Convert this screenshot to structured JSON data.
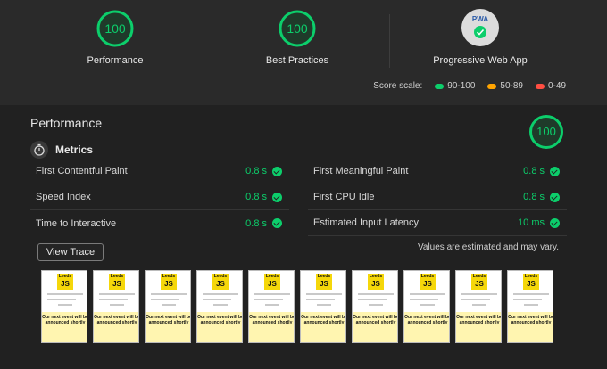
{
  "top": {
    "gauges": [
      {
        "score": "100",
        "label": "Performance"
      },
      {
        "score": "100",
        "label": "Best Practices"
      }
    ],
    "pwa": {
      "badge": "PWA",
      "label": "Progressive Web App"
    }
  },
  "scale": {
    "title": "Score scale:",
    "ranges": [
      {
        "label": "90-100",
        "color": "#0cce6b"
      },
      {
        "label": "50-89",
        "color": "#ffa400"
      },
      {
        "label": "0-49",
        "color": "#ff4e42"
      }
    ]
  },
  "performance": {
    "title": "Performance",
    "score": "100",
    "metrics_title": "Metrics",
    "left": [
      {
        "name": "First Contentful Paint",
        "value": "0.8 s"
      },
      {
        "name": "Speed Index",
        "value": "0.8 s"
      },
      {
        "name": "Time to Interactive",
        "value": "0.8 s"
      }
    ],
    "right": [
      {
        "name": "First Meaningful Paint",
        "value": "0.8 s"
      },
      {
        "name": "First CPU Idle",
        "value": "0.8 s"
      },
      {
        "name": "Estimated Input Latency",
        "value": "10 ms"
      }
    ],
    "view_trace": "View Trace",
    "note": "Values are estimated and may vary."
  },
  "filmstrip": {
    "frame_count": 10,
    "logo_top": "Leeds",
    "logo_main": "JS",
    "event_text": "Our next event will be announced shortly"
  },
  "colors": {
    "pass": "#0cce6b",
    "background": "#212121"
  }
}
